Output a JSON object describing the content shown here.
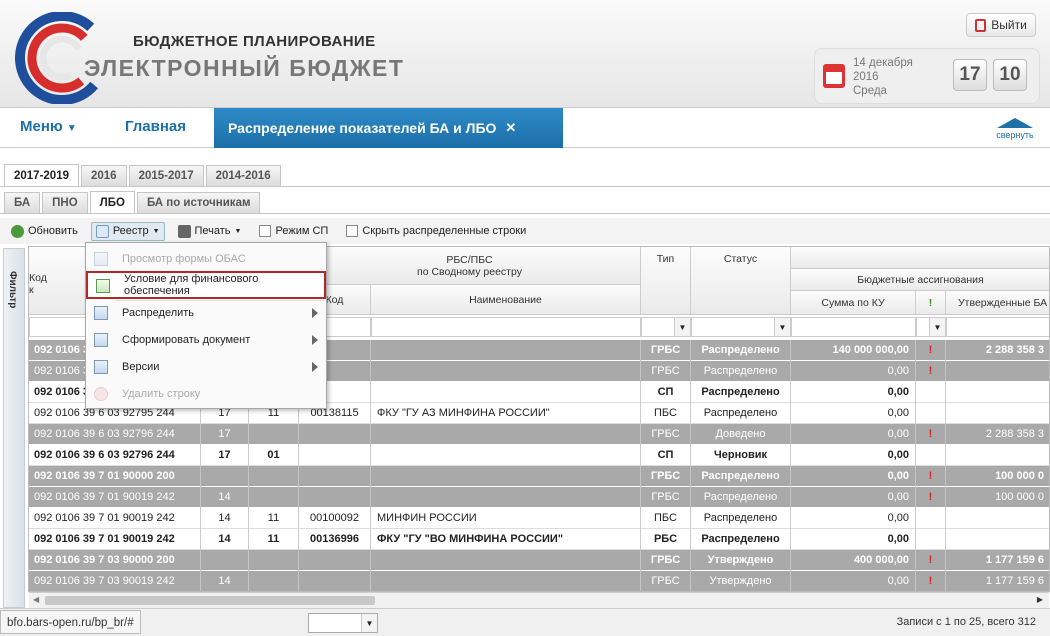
{
  "header": {
    "brand_line1": "БЮДЖЕТНОЕ ПЛАНИРОВАНИЕ",
    "brand_line2": "ЭЛЕКТРОННЫЙ БЮДЖЕТ",
    "exit_label": "Выйти",
    "date_line1": "14 декабря",
    "date_line2": "2016",
    "date_line3": "Среда",
    "clock_hours": "17",
    "clock_minutes": "10"
  },
  "nav": {
    "menu_label": "Меню",
    "home_label": "Главная",
    "active_tab": "Распределение показателей БА и ЛБО",
    "close_glyph": "✕",
    "collapse_label": "свернуть"
  },
  "year_tabs": [
    "2017-2019",
    "2016",
    "2015-2017",
    "2014-2016"
  ],
  "type_tabs": [
    "БА",
    "ПНО",
    "ЛБО",
    "БА по источникам"
  ],
  "toolbar": {
    "refresh": "Обновить",
    "registry": "Реестр",
    "print": "Печать",
    "sp_mode": "Режим СП",
    "hide_rows": "Скрыть распределенные строки"
  },
  "filter_label": "Фильтр",
  "columns": {
    "code": "Код",
    "code_sub": "к",
    "rbs": "РБС/ПБС",
    "rbs_sub": "по Сводному реестру",
    "kod": "Код",
    "name": "Наименование",
    "type": "Тип",
    "status": "Статус",
    "ba": "Бюджетные ассигнования",
    "sum_ku": "Сумма по КУ",
    "excl": "!",
    "approved": "Утвержденные БА"
  },
  "rows": [
    {
      "code": "092 0106 39 6 03 00000 000",
      "c2": "",
      "c3": "",
      "kod": "",
      "name": "",
      "type": "ГРБС",
      "status": "Распределено",
      "sum": "140 000 000,00",
      "flag": "!",
      "approved": "2 288 358 3",
      "style": "g bold"
    },
    {
      "code": "092 0106 39 6 03 92796 244",
      "c2": "",
      "c3": "",
      "kod": "",
      "name": "",
      "type": "ГРБС",
      "status": "Распределено",
      "sum": "0,00",
      "flag": "!",
      "approved": "",
      "style": "g"
    },
    {
      "code": "092 0106 39 6 03 92796 244",
      "c2": "",
      "c3": "",
      "kod": "",
      "name": "",
      "type": "СП",
      "status": "Распределено",
      "sum": "0,00",
      "flag": "",
      "approved": "",
      "style": "w bold"
    },
    {
      "code": "092 0106 39 6 03 92795 244",
      "c2": "17",
      "c3": "11",
      "kod": "00138115",
      "name": "ФКУ \"ГУ АЗ МИНФИНА РОССИИ\"",
      "type": "ПБС",
      "status": "Распределено",
      "sum": "0,00",
      "flag": "",
      "approved": "",
      "style": "w"
    },
    {
      "code": "092 0106 39 6 03 92796 244",
      "c2": "17",
      "c3": "",
      "kod": "",
      "name": "",
      "type": "ГРБС",
      "status": "Доведено",
      "sum": "0,00",
      "flag": "!",
      "approved": "2 288 358 3",
      "style": "g"
    },
    {
      "code": "092 0106 39 6 03 92796 244",
      "c2": "17",
      "c3": "01",
      "kod": "",
      "name": "",
      "type": "СП",
      "status": "Черновик",
      "sum": "0,00",
      "flag": "",
      "approved": "",
      "style": "w bold"
    },
    {
      "code": "092 0106 39 7 01 90000 200",
      "c2": "",
      "c3": "",
      "kod": "",
      "name": "",
      "type": "ГРБС",
      "status": "Распределено",
      "sum": "0,00",
      "flag": "!",
      "approved": "100 000 0",
      "style": "g bold"
    },
    {
      "code": "092 0106 39 7 01 90019 242",
      "c2": "14",
      "c3": "",
      "kod": "",
      "name": "",
      "type": "ГРБС",
      "status": "Распределено",
      "sum": "0,00",
      "flag": "!",
      "approved": "100 000 0",
      "style": "g"
    },
    {
      "code": "092 0106 39 7 01 90019 242",
      "c2": "14",
      "c3": "11",
      "kod": "00100092",
      "name": "МИНФИН РОССИИ",
      "type": "ПБС",
      "status": "Распределено",
      "sum": "0,00",
      "flag": "",
      "approved": "",
      "style": "w"
    },
    {
      "code": "092 0106 39 7 01 90019 242",
      "c2": "14",
      "c3": "11",
      "kod": "00136996",
      "name": "ФКУ \"ГУ \"ВО МИНФИНА РОССИИ\"",
      "type": "РБС",
      "status": "Распределено",
      "sum": "0,00",
      "flag": "",
      "approved": "",
      "style": "w bold"
    },
    {
      "code": "092 0106 39 7 03 90000 200",
      "c2": "",
      "c3": "",
      "kod": "",
      "name": "",
      "type": "ГРБС",
      "status": "Утверждено",
      "sum": "400 000,00",
      "flag": "!",
      "approved": "1 177 159 6",
      "style": "g bold"
    },
    {
      "code": "092 0106 39 7 03 90019 242",
      "c2": "14",
      "c3": "",
      "kod": "",
      "name": "",
      "type": "ГРБС",
      "status": "Утверждено",
      "sum": "0,00",
      "flag": "!",
      "approved": "1 177 159 6",
      "style": "g"
    }
  ],
  "context_menu": [
    {
      "label": "Просмотр формы ОБАС",
      "disabled": true
    },
    {
      "label": "Условие для финансового обеспечения",
      "disabled": false
    },
    {
      "label": "Распределить",
      "disabled": false
    },
    {
      "label": "Сформировать документ",
      "disabled": false
    },
    {
      "label": "Версии",
      "disabled": false
    },
    {
      "label": "Удалить строку",
      "disabled": true
    }
  ],
  "status": {
    "url": "bfo.bars-open.ru/bp_br/#",
    "records": "Записи с 1 по 25, всего 312"
  },
  "colors": {
    "accent": "#1d70a8",
    "tab_bg": "#2e8ac6",
    "group_row": "#a9a9a9",
    "alert": "#d22222",
    "highlight_border": "#b02a2a"
  }
}
